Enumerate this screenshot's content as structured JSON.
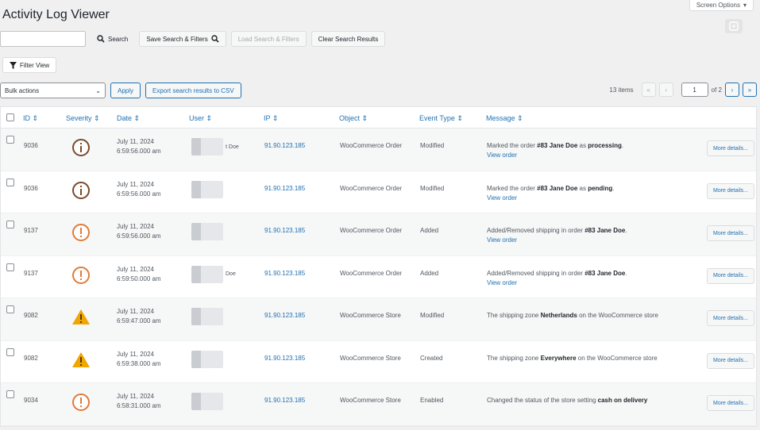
{
  "header": {
    "title": "Activity Log Viewer",
    "screen_options_label": "Screen Options"
  },
  "search": {
    "value": "",
    "search_label": "Search",
    "save_label": "Save Search & Filters",
    "load_label": "Load Search & Filters",
    "clear_label": "Clear Search Results"
  },
  "filter": {
    "label": "Filter View"
  },
  "bulk": {
    "selected": "Bulk actions",
    "apply_label": "Apply",
    "export_label": "Export search results to CSV"
  },
  "pagination": {
    "items": "13 items",
    "first": "«",
    "prev": "‹",
    "current": "1",
    "of": "of 2",
    "next": "›",
    "last": "»"
  },
  "table": {
    "columns": [
      "ID",
      "Severity",
      "Date",
      "User",
      "IP",
      "Object",
      "Event Type",
      "Message"
    ],
    "more_label": "More details...",
    "view_order": "View order",
    "rows": [
      {
        "id": "9036",
        "severity": "info",
        "date": "July 11, 2024",
        "time": "6:59:56.000 am",
        "user": "t Doe",
        "ip": "91.90.123.185",
        "object": "WooCommerce Order",
        "event": "Modified",
        "msg_pre": "Marked the order ",
        "msg_b1": "#83 Jane Doe",
        "msg_mid": " as ",
        "msg_b2": "processing",
        "msg_post": ".",
        "has_link": true
      },
      {
        "id": "9036",
        "severity": "info",
        "date": "July 11, 2024",
        "time": "6:59:56.000 am",
        "user": "",
        "ip": "91.90.123.185",
        "object": "WooCommerce Order",
        "event": "Modified",
        "msg_pre": "Marked the order ",
        "msg_b1": "#83 Jane Doe",
        "msg_mid": " as ",
        "msg_b2": "pending",
        "msg_post": ".",
        "has_link": true
      },
      {
        "id": "9137",
        "severity": "warning",
        "date": "July 11, 2024",
        "time": "6:59:56.000 am",
        "user": "",
        "ip": "91.90.123.185",
        "object": "WooCommerce Order",
        "event": "Added",
        "msg_pre": "Added/Removed shipping in order ",
        "msg_b1": "#83 Jane Doe",
        "msg_mid": "",
        "msg_b2": "",
        "msg_post": ".",
        "has_link": true
      },
      {
        "id": "9137",
        "severity": "warning",
        "date": "July 11, 2024",
        "time": "6:59:50.000 am",
        "user": "Doe",
        "ip": "91.90.123.185",
        "object": "WooCommerce Order",
        "event": "Added",
        "msg_pre": "Added/Removed shipping in order ",
        "msg_b1": "#83 Jane Doe",
        "msg_mid": "",
        "msg_b2": "",
        "msg_post": ".",
        "has_link": true
      },
      {
        "id": "9082",
        "severity": "alert",
        "date": "July 11, 2024",
        "time": "6:59:47.000 am",
        "user": "",
        "ip": "91.90.123.185",
        "object": "WooCommerce Store",
        "event": "Modified",
        "msg_pre": "The shipping zone ",
        "msg_b1": "Netherlands",
        "msg_mid": " on the WooCommerce store",
        "msg_b2": "",
        "msg_post": "",
        "has_link": false
      },
      {
        "id": "9082",
        "severity": "alert",
        "date": "July 11, 2024",
        "time": "6:59:38.000 am",
        "user": "",
        "ip": "91.90.123.185",
        "object": "WooCommerce Store",
        "event": "Created",
        "msg_pre": "The shipping zone ",
        "msg_b1": "Everywhere",
        "msg_mid": " on the WooCommerce store",
        "msg_b2": "",
        "msg_post": "",
        "has_link": false
      },
      {
        "id": "9034",
        "severity": "warning",
        "date": "July 11, 2024",
        "time": "6:58:31.000 am",
        "user": "",
        "ip": "91.90.123.185",
        "object": "WooCommerce Store",
        "event": "Enabled",
        "msg_pre": "Changed the status of the store setting ",
        "msg_b1": "cash on delivery",
        "msg_mid": "",
        "msg_b2": "",
        "msg_post": "",
        "has_link": false
      }
    ]
  },
  "colors": {
    "link": "#2271b1",
    "info": "#7a4a2a",
    "warning": "#e07b39",
    "alert": "#f0a500"
  }
}
